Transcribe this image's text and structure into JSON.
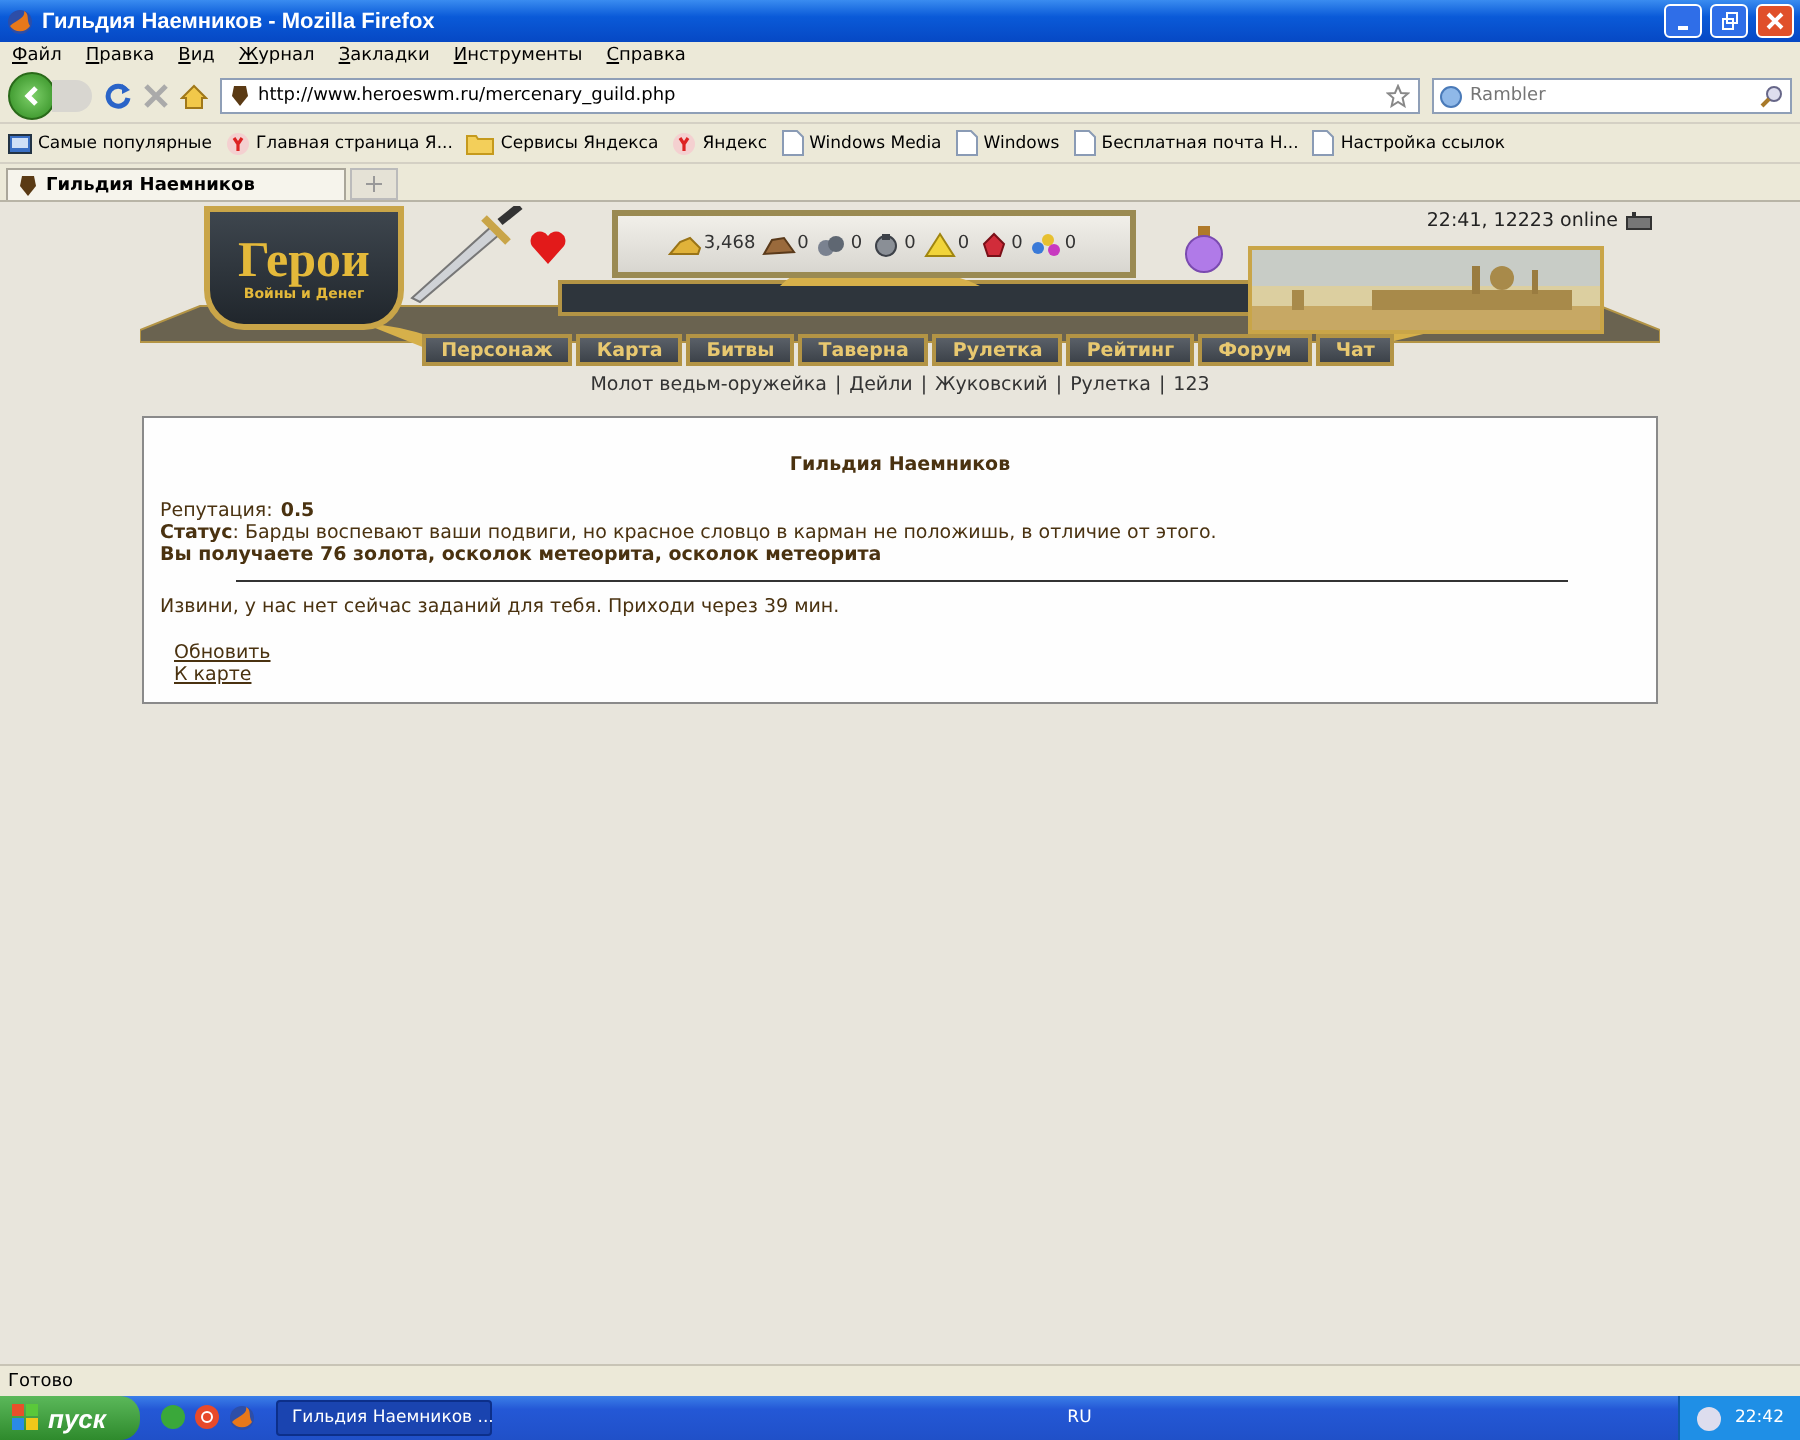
{
  "window": {
    "title": "Гильдия Наемников - Mozilla Firefox"
  },
  "menu": [
    "Файл",
    "Правка",
    "Вид",
    "Журнал",
    "Закладки",
    "Инструменты",
    "Справка"
  ],
  "address": {
    "value": "http://www.heroeswm.ru/mercenary_guild.php"
  },
  "search": {
    "placeholder": "Rambler"
  },
  "bookmarks": [
    {
      "label": "Самые популярные",
      "kind": "popular"
    },
    {
      "label": "Главная страница Я...",
      "kind": "yandex"
    },
    {
      "label": "Сервисы Яндекса",
      "kind": "folder"
    },
    {
      "label": "Яндекс",
      "kind": "yandex"
    },
    {
      "label": "Windows Media",
      "kind": "page"
    },
    {
      "label": "Windows",
      "kind": "page"
    },
    {
      "label": "Бесплатная почта Н...",
      "kind": "page"
    },
    {
      "label": "Настройка ссылок",
      "kind": "page"
    }
  ],
  "tabs": [
    {
      "label": "Гильдия Наемников",
      "selected": true
    }
  ],
  "game": {
    "logo_title": "Герои",
    "logo_subtitle": "Войны и Денег",
    "server_info": "22:41, 12223 online",
    "resources": [
      {
        "kind": "gold",
        "value": "3,468"
      },
      {
        "kind": "wood",
        "value": "0"
      },
      {
        "kind": "ore",
        "value": "0"
      },
      {
        "kind": "mercury",
        "value": "0"
      },
      {
        "kind": "sulfur",
        "value": "0"
      },
      {
        "kind": "crystal",
        "value": "0"
      },
      {
        "kind": "gems",
        "value": "0"
      }
    ],
    "nav": [
      "Персонаж",
      "Карта",
      "Битвы",
      "Таверна",
      "Рулетка",
      "Рейтинг",
      "Форум",
      "Чат"
    ],
    "quick_links": {
      "separator": "|",
      "items": [
        "Молот ведьм-оружейка",
        "Дейли",
        "Жуковский",
        "Рулетка",
        "123"
      ]
    }
  },
  "guild": {
    "title": "Гильдия Наемников",
    "reputation_label": "Репутация:",
    "reputation_value": "0.5",
    "status": "**Статус**: Барды воспевают ваши подвиги, но красное словцо в карман не положишь, в отличие от этого.",
    "reward": "Вы получаете 76 золота, осколок метеорита, осколок метеорита",
    "message": "Извини, у нас нет сейчас заданий для тебя. Приходи через 39 мин.",
    "links": [
      "Обновить",
      "К карте"
    ]
  },
  "status_bar": "Готово",
  "taskbar": {
    "start": "пуск",
    "task": "Гильдия Наемников ...",
    "language": "RU",
    "clock": "22:42"
  }
}
